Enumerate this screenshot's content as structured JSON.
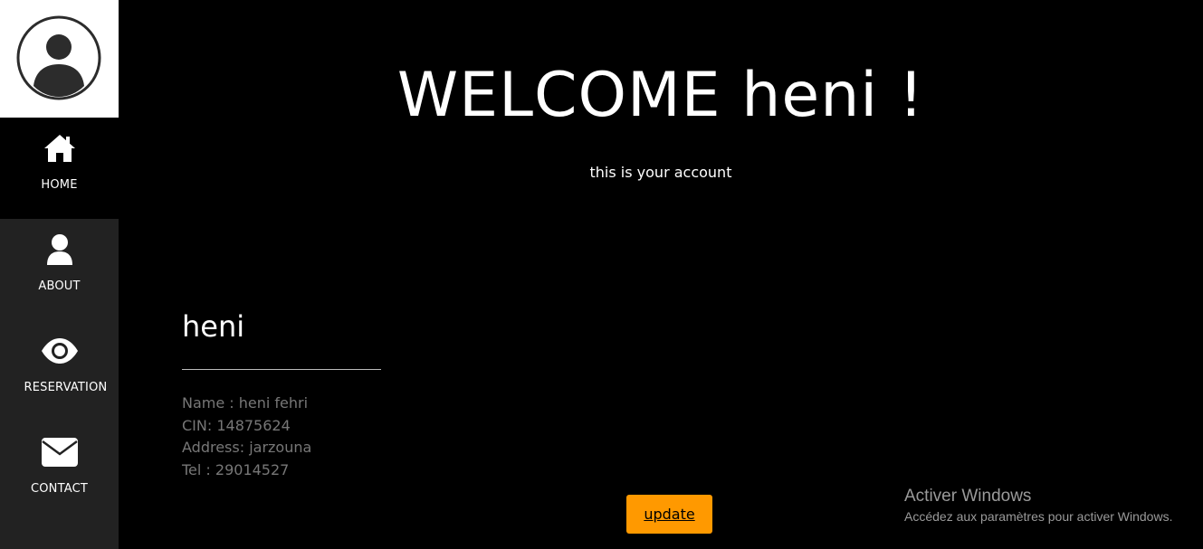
{
  "sidebar": {
    "items": [
      {
        "label": "HOME",
        "icon": "home-icon"
      },
      {
        "label": "ABOUT",
        "icon": "user-icon"
      },
      {
        "label": "RESERVATION",
        "icon": "eye-icon"
      },
      {
        "label": "CONTACT",
        "icon": "envelope-icon"
      }
    ]
  },
  "main": {
    "title": "WELCOME heni !",
    "subtitle": "this is your account"
  },
  "profile": {
    "name": "heni",
    "details": {
      "name_line": "Name : heni fehri",
      "cin_line": "CIN: 14875624",
      "address_line": "Address: jarzouna",
      "tel_line": "Tel : 29014527"
    },
    "update_label": "update"
  },
  "watermark": {
    "title": "Activer Windows",
    "subtitle": "Accédez aux paramètres pour activer Windows."
  },
  "colors": {
    "background": "#000000",
    "sidebar": "#222222",
    "accent": "#ff9900"
  }
}
